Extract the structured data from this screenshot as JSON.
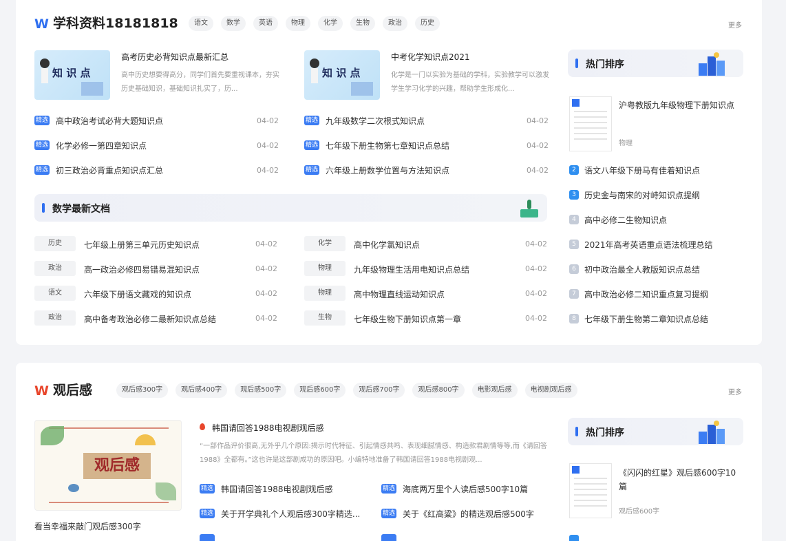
{
  "section1": {
    "logo": "W",
    "title": "学科资料18181818",
    "tags": [
      "语文",
      "数学",
      "英语",
      "物理",
      "化学",
      "生物",
      "政治",
      "历史"
    ],
    "more": "更多",
    "features": [
      {
        "thumb_text": "知 识 点",
        "title": "高考历史必背知识点最新汇总",
        "desc": "高中历史想要得高分，同学们首先要重视课本，夯实历史基础知识，基础知识扎实了，历..."
      },
      {
        "thumb_text": "知 识 点",
        "title": "中考化学知识点2021",
        "desc": "化学是一门以实验为基础的学科，实验教学可以激发学生学习化学的兴趣，帮助学生形成化..."
      }
    ],
    "picked_badge": "精选",
    "picked_left": [
      {
        "title": "高中政治考试必背大题知识点",
        "date": "04-02"
      },
      {
        "title": "化学必修一第四章知识点",
        "date": "04-02"
      },
      {
        "title": "初三政治必背重点知识点汇总",
        "date": "04-02"
      }
    ],
    "picked_right": [
      {
        "title": "九年级数学二次根式知识点",
        "date": "04-02"
      },
      {
        "title": "七年级下册生物第七章知识点总结",
        "date": "04-02"
      },
      {
        "title": "六年级上册数学位置与方法知识点",
        "date": "04-02"
      }
    ],
    "math_header": "数学最新文档",
    "docs_left": [
      {
        "subject": "历史",
        "title": "七年级上册第三单元历史知识点",
        "date": "04-02"
      },
      {
        "subject": "政治",
        "title": "高一政治必修四易错易混知识点",
        "date": "04-02"
      },
      {
        "subject": "语文",
        "title": "六年级下册语文藏戏的知识点",
        "date": "04-02"
      },
      {
        "subject": "政治",
        "title": "高中备考政治必修二最新知识点总结",
        "date": "04-02"
      }
    ],
    "docs_right": [
      {
        "subject": "化学",
        "title": "高中化学氯知识点",
        "date": "04-02"
      },
      {
        "subject": "物理",
        "title": "九年级物理生活用电知识点总结",
        "date": "04-02"
      },
      {
        "subject": "物理",
        "title": "高中物理直线运动知识点",
        "date": "04-02"
      },
      {
        "subject": "生物",
        "title": "七年级生物下册知识点第一章",
        "date": "04-02"
      }
    ],
    "hot": {
      "header": "热门排序",
      "top": {
        "title": "沪粤教版九年级物理下册知识点",
        "category": "物理"
      },
      "items": [
        {
          "n": "2",
          "title": "语文八年级下册马有佳着知识点",
          "color": "#2f8ff0"
        },
        {
          "n": "3",
          "title": "历史金与南宋的对峙知识点提纲",
          "color": "#2f8ff0"
        },
        {
          "n": "4",
          "title": "高中必修二生物知识点",
          "color": "#c5ccd8"
        },
        {
          "n": "5",
          "title": "2021年高考英语重点语法梳理总结",
          "color": "#c5ccd8"
        },
        {
          "n": "6",
          "title": "初中政治最全人教版知识点总结",
          "color": "#c5ccd8"
        },
        {
          "n": "7",
          "title": "高中政治必修二知识重点复习提纲",
          "color": "#c5ccd8"
        },
        {
          "n": "8",
          "title": "七年级下册生物第二章知识点总结",
          "color": "#c5ccd8"
        }
      ]
    }
  },
  "section2": {
    "logo": "W",
    "title": "观后感",
    "tags": [
      "观后感300字",
      "观后感400字",
      "观后感500字",
      "观后感600字",
      "观后感700字",
      "观后感800字",
      "电影观后感",
      "电视剧观后感"
    ],
    "more": "更多",
    "banner_text": "观后感",
    "banner_caption": "看当幸福来敲门观后感300字",
    "feature_title": "韩国请回答1988电视剧观后感",
    "feature_desc": "“一部作品评价很高,无外乎几个原因:揭示时代特征、引起情感共鸣、表现细腻情感、构造款君剧情等等,而《请回答1988》全都有。”这也许是这部剧成功的原因吧。小编特地准备了韩国请回答1988电视剧观...",
    "picked_badge": "精选",
    "picked": [
      {
        "title": "韩国请回答1988电视剧观后感"
      },
      {
        "title": "海底两万里个人读后感500字10篇"
      },
      {
        "title": "关于开学典礼个人观后感300字精选..."
      },
      {
        "title": "关于《红高粱》的精选观后感500字"
      }
    ],
    "hot": {
      "header": "热门排序",
      "top": {
        "title": "《闪闪的红星》观后感600字10篇",
        "category": "观后感600字"
      }
    }
  },
  "colors": {
    "accent": "#2f6ff0",
    "logo2": "#e8462c",
    "badge": "#3b7cf3"
  }
}
